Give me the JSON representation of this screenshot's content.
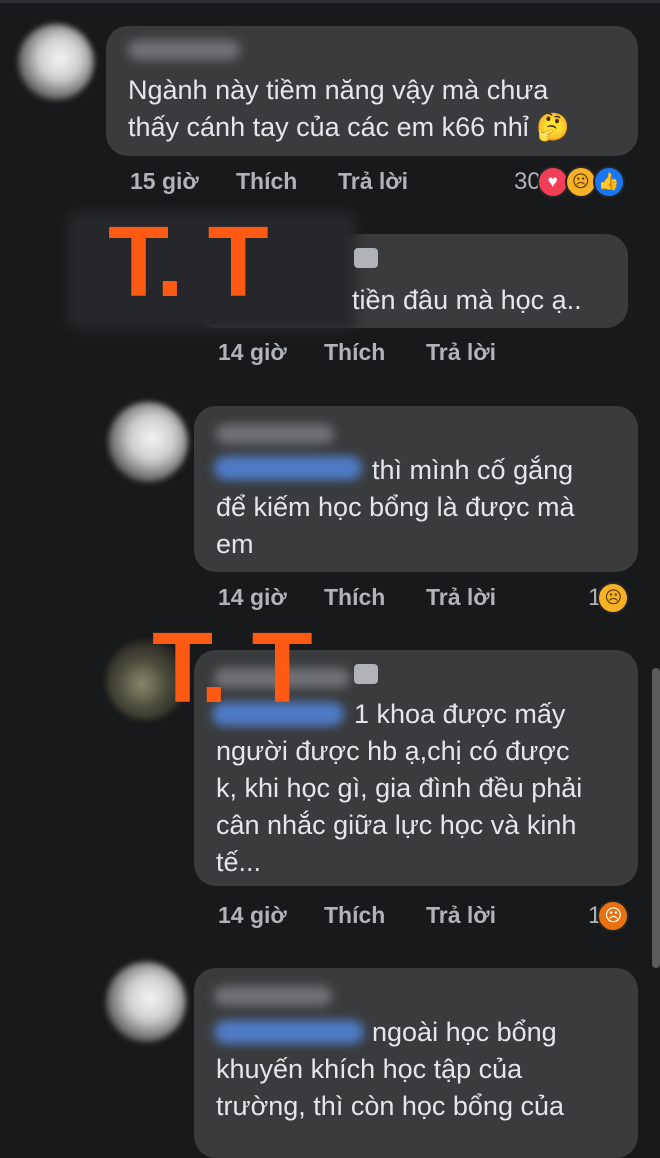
{
  "comments": [
    {
      "text": "Ngành này tiềm năng vậy mà chưa\nthấy cánh tay của các em k66 nhỉ 🤔",
      "time": "15 giờ",
      "like": "Thích",
      "reply": "Trả lời",
      "reaction_count": "30",
      "reactions": [
        "heart-icon",
        "sad-icon",
        "like-icon"
      ]
    },
    {
      "text": "tiền đâu mà học ạ..",
      "time": "14 giờ",
      "like": "Thích",
      "reply": "Trả lời"
    },
    {
      "text_first": "thì mình cố gắng",
      "text_rest": "để kiếm học bổng là được mà\nem",
      "time": "14 giờ",
      "like": "Thích",
      "reply": "Trả lời",
      "reaction_count": "1",
      "reactions": [
        "sad-icon"
      ]
    },
    {
      "text_first": "1 khoa được mấy",
      "text_rest": "người được hb ạ,chị có được\nk, khi học gì, gia đình đều phải\ncân nhắc giữa lực học và kinh\ntế...",
      "time": "14 giờ",
      "like": "Thích",
      "reply": "Trả lời",
      "reaction_count": "1",
      "reactions": [
        "angry-icon"
      ]
    },
    {
      "text_first": "ngoài học bổng",
      "text_rest": "khuyến khích học tập của\ntrường, thì còn học bổng của"
    }
  ],
  "overlays": {
    "tt1": "T. T",
    "tt2": "T. T"
  },
  "colors": {
    "overlay": "#ff5a14",
    "bubble": "#3a3b3c",
    "background": "#18191a"
  }
}
